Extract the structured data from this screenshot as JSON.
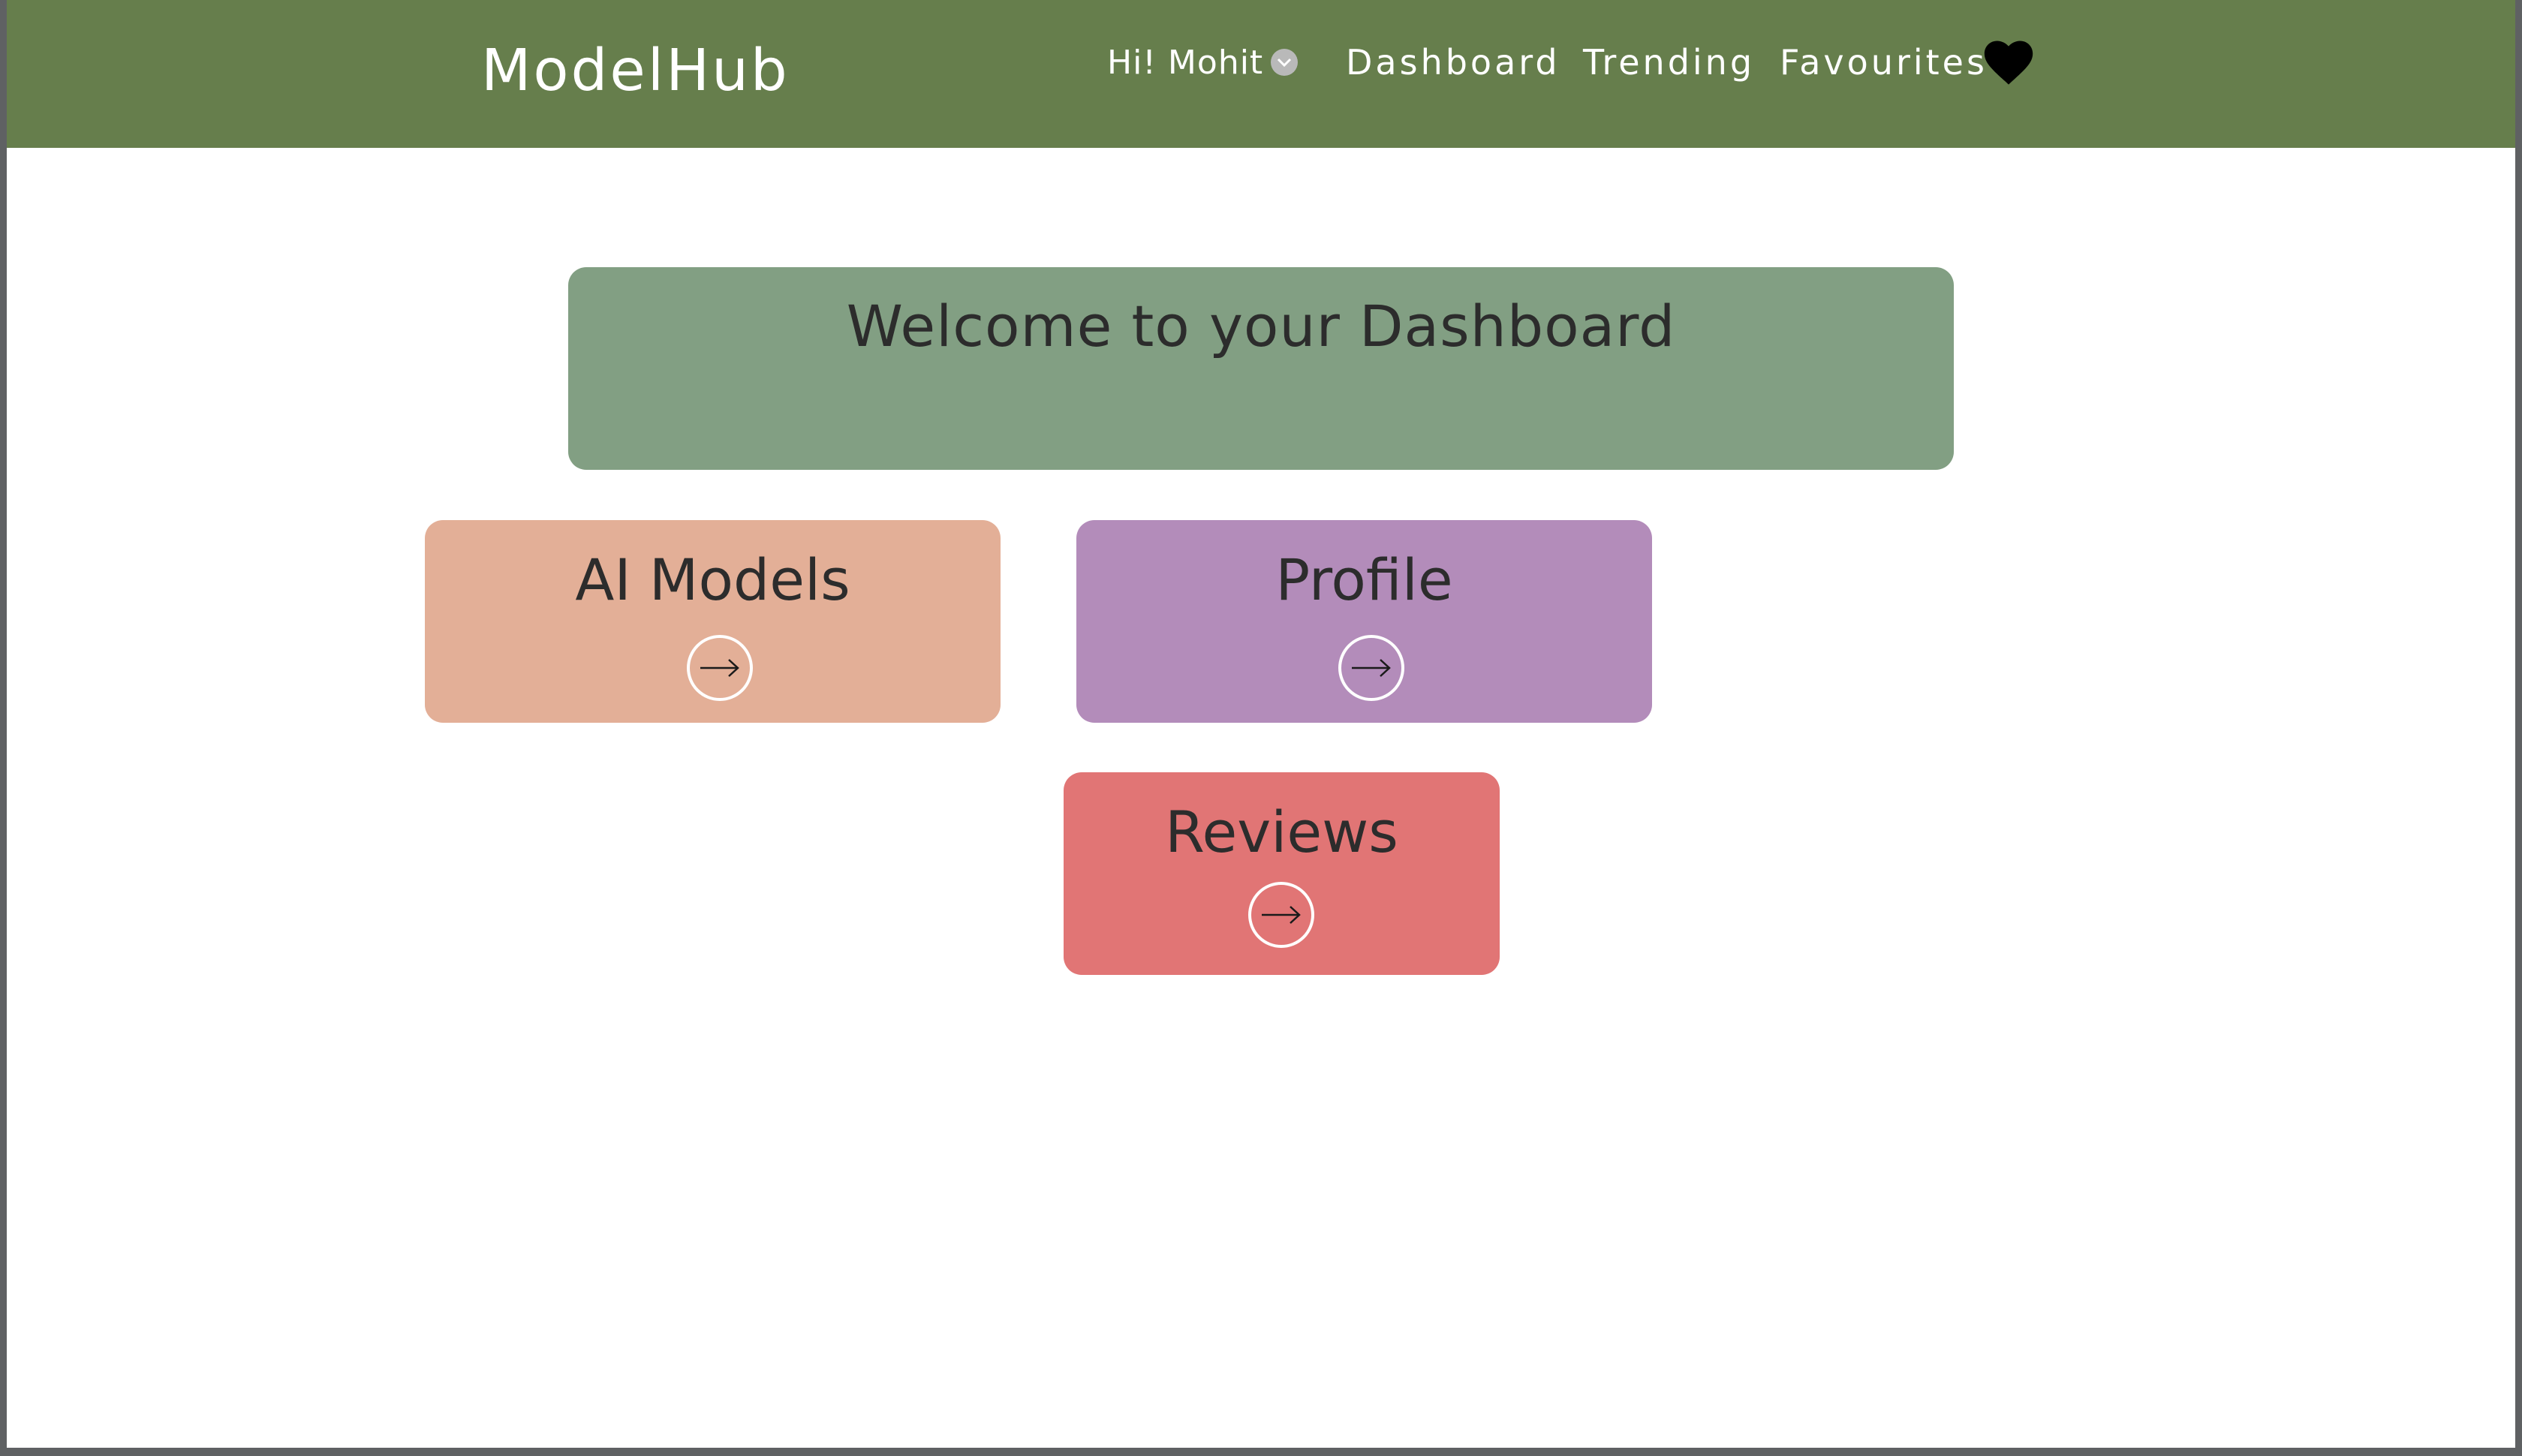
{
  "nav": {
    "brand": "ModelHub",
    "greeting": "Hi! Mohit",
    "links": {
      "dashboard": "Dashboard",
      "trending": "Trending",
      "favourites": "Favourites"
    },
    "icons": {
      "greeting_dropdown": "chevron-down-icon",
      "favourites": "heart-icon"
    },
    "color": "#667e4c"
  },
  "welcome": {
    "title": "Welcome to your Dashboard",
    "color": "#829f83"
  },
  "cards": {
    "ai_models": {
      "label": "AI Models",
      "icon": "arrow-right-icon",
      "color": "#e3af97"
    },
    "profile": {
      "label": "Profile",
      "icon": "arrow-right-icon",
      "color": "#b38cba"
    },
    "reviews": {
      "label": "Reviews",
      "icon": "arrow-right-icon",
      "color": "#e17575"
    }
  }
}
